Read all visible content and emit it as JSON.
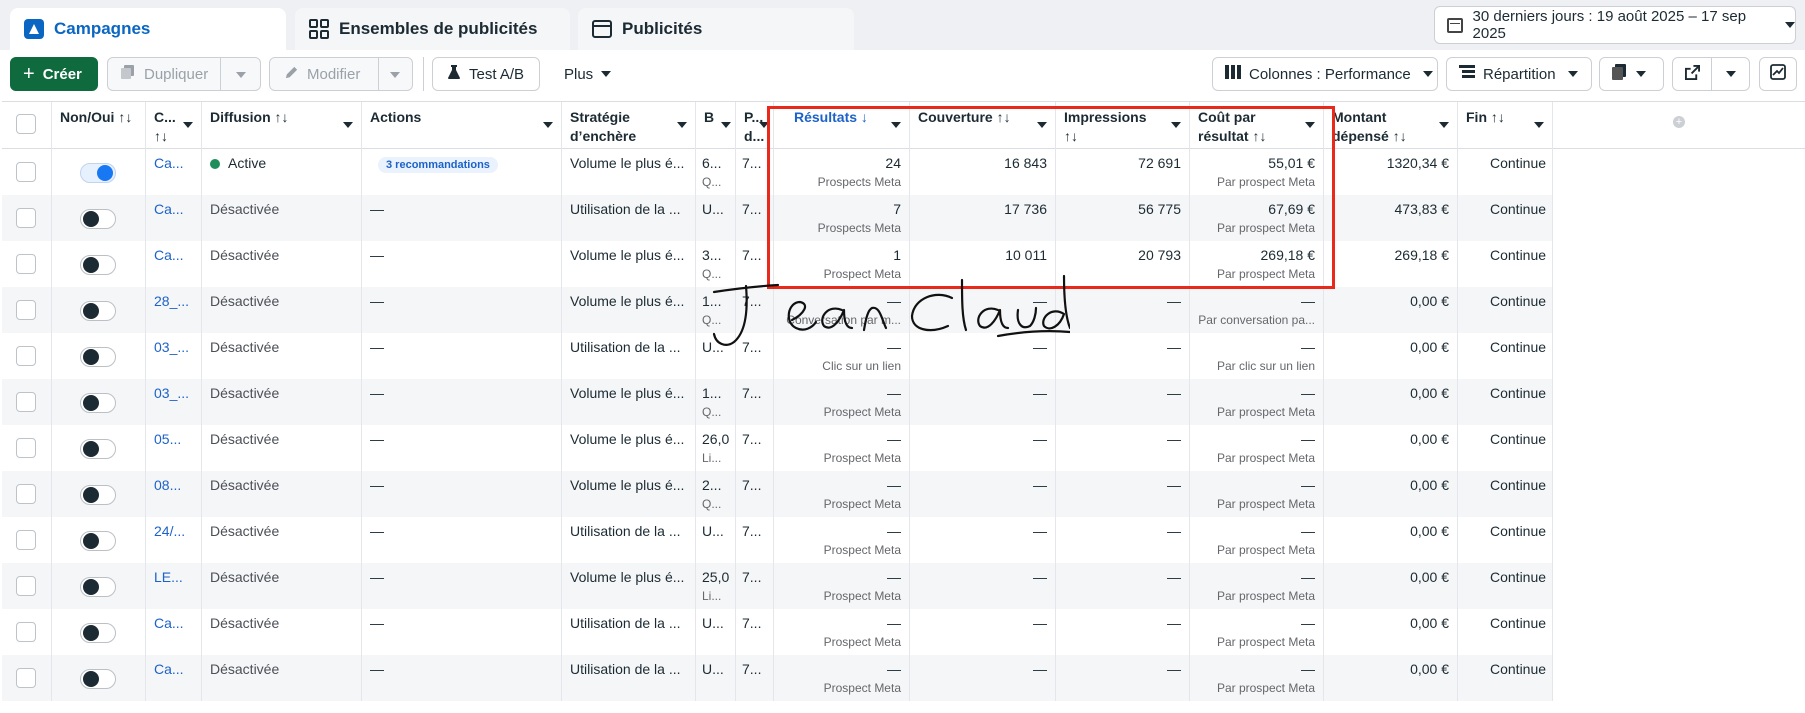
{
  "tabs": [
    {
      "label": "Campagnes",
      "icon": "campaign-flag-icon"
    },
    {
      "label": "Ensembles de publicités",
      "icon": "grid-icon"
    },
    {
      "label": "Publicités",
      "icon": "ad-card-icon"
    }
  ],
  "date_range": "30 derniers jours : 19 août 2025 – 17 sep 2025",
  "toolbar": {
    "create": "Créer",
    "duplicate": "Dupliquer",
    "edit": "Modifier",
    "ab_test": "Test A/B",
    "more": "Plus",
    "columns": "Colonnes : Performance",
    "breakdown": "Répartition"
  },
  "columns": {
    "toggle": "Non/Oui ↑↓",
    "campaign": "C... ↑↓",
    "delivery": "Diffusion ↑↓",
    "actions": "Actions",
    "bid_strategy": "Stratégie d’enchère",
    "budget": "B",
    "attr": "P... d...",
    "results": "Résultats ↓",
    "reach": "Couverture ↑↓",
    "impressions": "Impressions ↑↓",
    "cost_per_result": "Coût par résultat ↑↓",
    "amount_spent": "Montant dépensé ↑↓",
    "end": "Fin ↑↓"
  },
  "rows": [
    {
      "on": true,
      "name": "Ca...",
      "delivery": "Active",
      "actions": "3 recommandations",
      "bid": "Volume le plus é...",
      "b1": "6...",
      "b2": "Q...",
      "p": "7...",
      "results": "24",
      "results_sub": "Prospects Meta",
      "reach": "16 843",
      "impr": "72 691",
      "cpr": "55,01 €",
      "cpr_sub": "Par prospect Meta",
      "spent": "1320,34 €",
      "end": "Continue"
    },
    {
      "on": false,
      "name": "Ca...",
      "delivery": "Désactivée",
      "actions": "—",
      "bid": "Utilisation de la ...",
      "b1": "U...",
      "b2": "",
      "p": "7...",
      "results": "7",
      "results_sub": "Prospects Meta",
      "reach": "17 736",
      "impr": "56 775",
      "cpr": "67,69 €",
      "cpr_sub": "Par prospect Meta",
      "spent": "473,83 €",
      "end": "Continue"
    },
    {
      "on": false,
      "name": "Ca...",
      "delivery": "Désactivée",
      "actions": "—",
      "bid": "Volume le plus é...",
      "b1": "3...",
      "b2": "Q...",
      "p": "7...",
      "results": "1",
      "results_sub": "Prospect Meta",
      "reach": "10 011",
      "impr": "20 793",
      "cpr": "269,18 €",
      "cpr_sub": "Par prospect Meta",
      "spent": "269,18 €",
      "end": "Continue"
    },
    {
      "on": false,
      "name": "28_...",
      "delivery": "Désactivée",
      "actions": "—",
      "bid": "Volume le plus é...",
      "b1": "1...",
      "b2": "Q...",
      "p": "7...",
      "results": "—",
      "results_sub": "Conversation par m...",
      "reach": "—",
      "impr": "—",
      "cpr": "—",
      "cpr_sub": "Par conversation pa...",
      "spent": "0,00 €",
      "end": "Continue"
    },
    {
      "on": false,
      "name": "03_...",
      "delivery": "Désactivée",
      "actions": "—",
      "bid": "Utilisation de la ...",
      "b1": "U...",
      "b2": "",
      "p": "7...",
      "results": "—",
      "results_sub": "Clic sur un lien",
      "reach": "—",
      "impr": "—",
      "cpr": "—",
      "cpr_sub": "Par clic sur un lien",
      "spent": "0,00 €",
      "end": "Continue"
    },
    {
      "on": false,
      "name": "03_...",
      "delivery": "Désactivée",
      "actions": "—",
      "bid": "Volume le plus é...",
      "b1": "1...",
      "b2": "Q...",
      "p": "7...",
      "results": "—",
      "results_sub": "Prospect Meta",
      "reach": "—",
      "impr": "—",
      "cpr": "—",
      "cpr_sub": "Par prospect Meta",
      "spent": "0,00 €",
      "end": "Continue"
    },
    {
      "on": false,
      "name": "05...",
      "delivery": "Désactivée",
      "actions": "—",
      "bid": "Volume le plus é...",
      "b1": "26,0",
      "b2": "Li...",
      "p": "7...",
      "results": "—",
      "results_sub": "Prospect Meta",
      "reach": "—",
      "impr": "—",
      "cpr": "—",
      "cpr_sub": "Par prospect Meta",
      "spent": "0,00 €",
      "end": "Continue"
    },
    {
      "on": false,
      "name": "08...",
      "delivery": "Désactivée",
      "actions": "—",
      "bid": "Volume le plus é...",
      "b1": "2...",
      "b2": "Q...",
      "p": "7...",
      "results": "—",
      "results_sub": "Prospect Meta",
      "reach": "—",
      "impr": "—",
      "cpr": "—",
      "cpr_sub": "Par prospect Meta",
      "spent": "0,00 €",
      "end": "Continue"
    },
    {
      "on": false,
      "name": "24/...",
      "delivery": "Désactivée",
      "actions": "—",
      "bid": "Utilisation de la ...",
      "b1": "U...",
      "b2": "",
      "p": "7...",
      "results": "—",
      "results_sub": "Prospect Meta",
      "reach": "—",
      "impr": "—",
      "cpr": "—",
      "cpr_sub": "Par prospect Meta",
      "spent": "0,00 €",
      "end": "Continue"
    },
    {
      "on": false,
      "name": "LE...",
      "delivery": "Désactivée",
      "actions": "—",
      "bid": "Volume le plus é...",
      "b1": "25,0",
      "b2": "Li...",
      "p": "7...",
      "results": "—",
      "results_sub": "Prospect Meta",
      "reach": "—",
      "impr": "—",
      "cpr": "—",
      "cpr_sub": "Par prospect Meta",
      "spent": "0,00 €",
      "end": "Continue"
    },
    {
      "on": false,
      "name": "Ca...",
      "delivery": "Désactivée",
      "actions": "—",
      "bid": "Utilisation de la ...",
      "b1": "U...",
      "b2": "",
      "p": "7...",
      "results": "—",
      "results_sub": "Prospect Meta",
      "reach": "—",
      "impr": "—",
      "cpr": "—",
      "cpr_sub": "Par prospect Meta",
      "spent": "0,00 €",
      "end": "Continue"
    },
    {
      "on": false,
      "name": "Ca...",
      "delivery": "Désactivée",
      "actions": "—",
      "bid": "Utilisation de la ...",
      "b1": "U...",
      "b2": "",
      "p": "7...",
      "results": "—",
      "results_sub": "Prospect Meta",
      "reach": "—",
      "impr": "—",
      "cpr": "—",
      "cpr_sub": "Par prospect Meta",
      "spent": "0,00 €",
      "end": "Continue"
    }
  ],
  "annotation": {
    "signature_text": "Jean Claude"
  },
  "colors": {
    "accent": "#0a66c2",
    "create_button": "#0f6b3e",
    "highlight_box": "#e8291c",
    "active_dot": "#1e8f5a"
  }
}
